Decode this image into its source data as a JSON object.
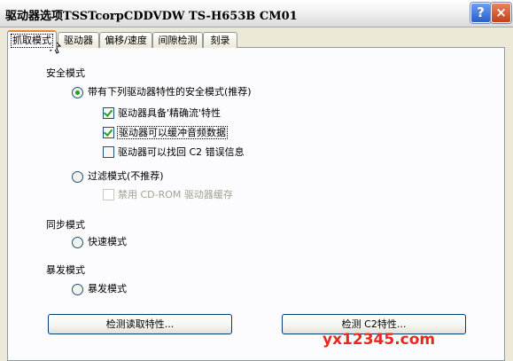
{
  "window": {
    "title": "驱动器选项TSSTcorpCDDVDW TS-H653B CM01",
    "help_label": "?",
    "close_label": "×"
  },
  "tabs": [
    {
      "label": "抓取模式",
      "active": true
    },
    {
      "label": "驱动器",
      "active": false
    },
    {
      "label": "偏移/速度",
      "active": false
    },
    {
      "label": "间隙检测",
      "active": false
    },
    {
      "label": "刻录",
      "active": false
    }
  ],
  "safe_mode": {
    "group_label": "安全模式",
    "radio_label": "带有下列驱动器特性的安全模式(推荐)",
    "selected": true,
    "features": [
      {
        "label": "驱动器具备'精确流'特性",
        "checked": true
      },
      {
        "label": "驱动器可以缓冲音频数据",
        "checked": true
      },
      {
        "label": "驱动器可以找回 C2 错误信息",
        "checked": false
      }
    ]
  },
  "burst_mode_safe": {
    "radio_label": "过滤模式(不推荐)",
    "selected": false,
    "disable_cache_label": "禁用 CD-ROM 驱动器缓存",
    "disable_cache_checked": false
  },
  "sync_mode": {
    "group_label": "同步模式",
    "radio_label": "快速模式",
    "selected": false
  },
  "burst_mode": {
    "group_label": "暴发模式",
    "radio_label": "暴发模式",
    "selected": false
  },
  "buttons": {
    "detect_read": "检测读取特性...",
    "detect_c2": "检测 C2特性..."
  },
  "watermark": "yx12345.com",
  "colors": {
    "dialog_bg": "#ECE9D8",
    "panel_bg": "#FCFCFE",
    "check_accent": "#21A121",
    "tab_highlight": "#E68B2C",
    "watermark": "#E8281C"
  }
}
